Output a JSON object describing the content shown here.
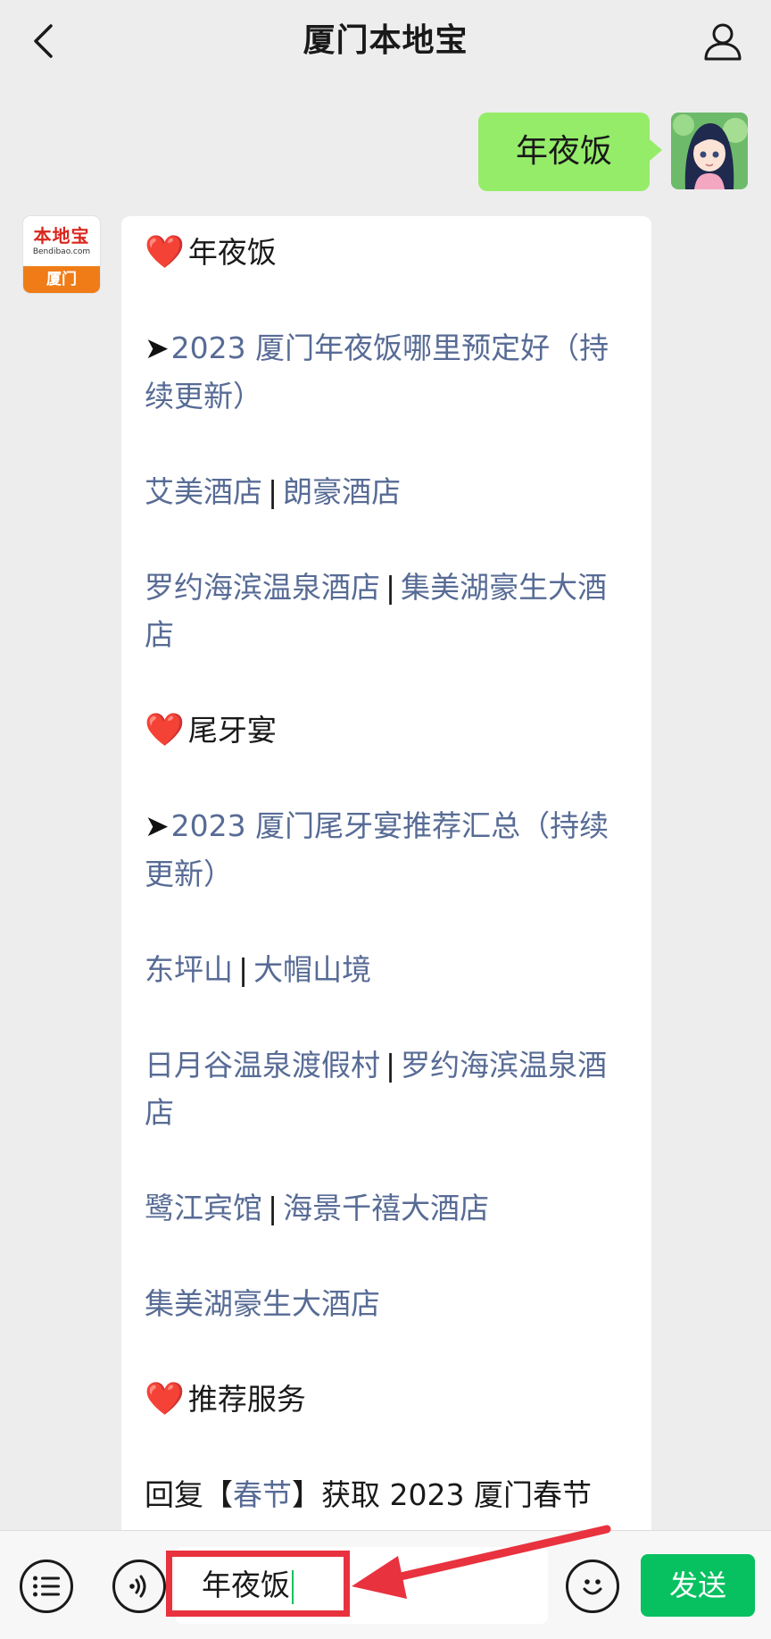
{
  "header": {
    "title": "厦门本地宝"
  },
  "outgoing": {
    "text": "年夜饭"
  },
  "bot": {
    "logo_text": "本地宝",
    "logo_domain": "Bendibao.com",
    "logo_city": "厦门"
  },
  "message": {
    "sections": [
      {
        "heart": "❤️",
        "heading": "年夜饭",
        "arrow": "➤",
        "feature_link": "2023 厦门年夜饭哪里预定好（持续更新）",
        "link_rows": [
          [
            "艾美酒店",
            "朗豪酒店"
          ],
          [
            "罗约海滨温泉酒店",
            "集美湖豪生大酒店"
          ]
        ]
      },
      {
        "heart": "❤️",
        "heading": "尾牙宴",
        "arrow": "➤",
        "feature_link": "2023 厦门尾牙宴推荐汇总（持续更新）",
        "link_rows": [
          [
            "东坪山",
            "大帽山境"
          ],
          [
            "日月谷温泉渡假村",
            "罗约海滨温泉酒店"
          ],
          [
            "鹭江宾馆",
            "海景千禧大酒店"
          ],
          [
            "集美湖豪生大酒店"
          ]
        ]
      }
    ],
    "services_heart": "❤️",
    "services_heading": "推荐服务",
    "reply_prefix": "回复【",
    "reply_keyword": "春节",
    "reply_suffix": "】获取 2023 厦门春节",
    "separator": "|"
  },
  "input_bar": {
    "input_value": "年夜饭",
    "send_label": "发送"
  },
  "colors": {
    "accent_green": "#07c160",
    "bubble_green": "#95ec69",
    "link_blue": "#576b95",
    "annotation_red": "#e8323e"
  }
}
